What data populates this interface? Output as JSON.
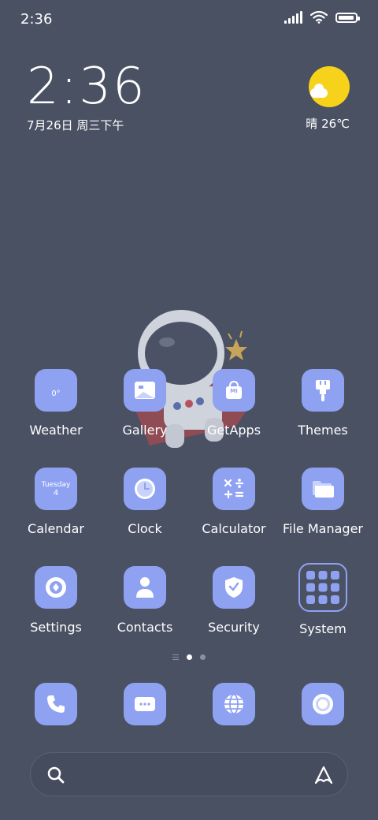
{
  "status_bar": {
    "time": "2:36"
  },
  "clock_widget": {
    "time": "2:36",
    "date": "7月26日 周三下午"
  },
  "weather_widget": {
    "condition_temp": "晴 26℃"
  },
  "apps": [
    {
      "label": "Weather",
      "icon": "weather-icon",
      "tile_text": "0°"
    },
    {
      "label": "Gallery",
      "icon": "gallery-icon"
    },
    {
      "label": "GetApps",
      "icon": "getapps-icon",
      "tile_text": "MI"
    },
    {
      "label": "Themes",
      "icon": "themes-icon"
    },
    {
      "label": "Calendar",
      "icon": "calendar-icon",
      "tile_day": "Tuesday",
      "tile_date": "4"
    },
    {
      "label": "Clock",
      "icon": "clock-icon"
    },
    {
      "label": "Calculator",
      "icon": "calculator-icon"
    },
    {
      "label": "File Manager",
      "icon": "folder-icon"
    },
    {
      "label": "Settings",
      "icon": "settings-icon"
    },
    {
      "label": "Contacts",
      "icon": "contacts-icon"
    },
    {
      "label": "Security",
      "icon": "shield-icon"
    },
    {
      "label": "System",
      "icon": "folder-grid-icon"
    }
  ],
  "dock": [
    {
      "icon": "phone-icon"
    },
    {
      "icon": "messages-icon"
    },
    {
      "icon": "browser-icon"
    },
    {
      "icon": "camera-icon"
    }
  ],
  "pager": {
    "pages": 2,
    "current": 1
  },
  "colors": {
    "background": "#4a5163",
    "icon_tile": "#8fa2f2",
    "sun": "#f7d21a"
  }
}
